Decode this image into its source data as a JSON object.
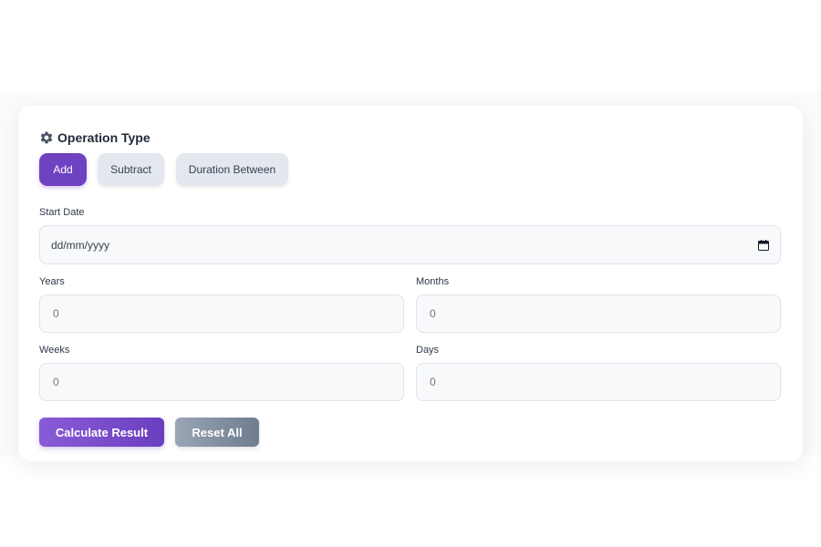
{
  "operation": {
    "title": "Operation Type",
    "icon": "gear-icon",
    "buttons": [
      {
        "label": "Add",
        "active": true
      },
      {
        "label": "Subtract",
        "active": false
      },
      {
        "label": "Duration Between",
        "active": false
      }
    ]
  },
  "start_date": {
    "label": "Start Date",
    "placeholder": "dd/mm/yyyy"
  },
  "fields": {
    "years": {
      "label": "Years",
      "placeholder": "0"
    },
    "months": {
      "label": "Months",
      "placeholder": "0"
    },
    "weeks": {
      "label": "Weeks",
      "placeholder": "0"
    },
    "days": {
      "label": "Days",
      "placeholder": "0"
    }
  },
  "actions": {
    "calculate_label": "Calculate Result",
    "reset_label": "Reset All"
  },
  "colors": {
    "accent": "#6f42c1",
    "secondary": "#e3e8ef",
    "reset": "#7f8a9c"
  }
}
